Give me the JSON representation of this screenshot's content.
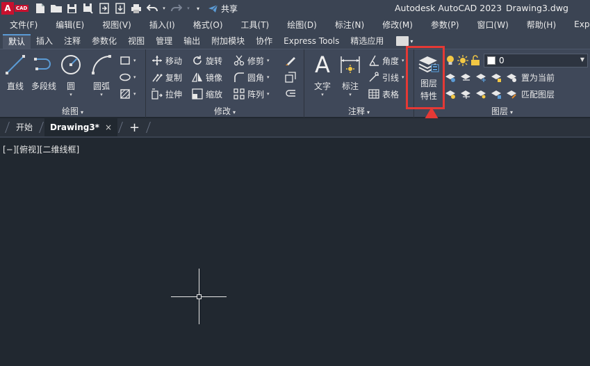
{
  "title_bar": {
    "logo_letter": "A",
    "logo_sub": "CAD",
    "share_label": "共享",
    "app_title": "Autodesk AutoCAD 2023",
    "file_name": "Drawing3.dwg",
    "quick_access_icons": [
      "new-icon",
      "open-icon",
      "save-icon",
      "save-as-icon",
      "open-web-icon",
      "save-web-icon",
      "plot-icon",
      "undo-icon",
      "redo-icon",
      "customize-icon",
      "share-icon"
    ]
  },
  "menu": [
    "文件(F)",
    "编辑(E)",
    "视图(V)",
    "插入(I)",
    "格式(O)",
    "工具(T)",
    "绘图(D)",
    "标注(N)",
    "修改(M)",
    "参数(P)",
    "窗口(W)",
    "帮助(H)",
    "Express"
  ],
  "ribbon_tabs": [
    {
      "label": "默认",
      "active": true
    },
    {
      "label": "插入"
    },
    {
      "label": "注释"
    },
    {
      "label": "参数化"
    },
    {
      "label": "视图"
    },
    {
      "label": "管理"
    },
    {
      "label": "输出"
    },
    {
      "label": "附加模块"
    },
    {
      "label": "协作"
    },
    {
      "label": "Express Tools"
    },
    {
      "label": "精选应用"
    }
  ],
  "panels": {
    "draw": {
      "title": "绘图",
      "tools": [
        {
          "label": "直线",
          "icon": "line-icon"
        },
        {
          "label": "多段线",
          "icon": "polyline-icon"
        },
        {
          "label": "圆",
          "icon": "circle-icon"
        },
        {
          "label": "圆弧",
          "icon": "arc-icon"
        }
      ]
    },
    "modify": {
      "title": "修改",
      "tools": [
        {
          "label": "移动",
          "icon": "move-icon"
        },
        {
          "label": "旋转",
          "icon": "rotate-icon"
        },
        {
          "label": "修剪",
          "icon": "trim-icon"
        },
        {
          "label": "复制",
          "icon": "copy-icon"
        },
        {
          "label": "镜像",
          "icon": "mirror-icon"
        },
        {
          "label": "圆角",
          "icon": "fillet-icon"
        },
        {
          "label": "拉伸",
          "icon": "stretch-icon"
        },
        {
          "label": "缩放",
          "icon": "scale-icon"
        },
        {
          "label": "阵列",
          "icon": "array-icon"
        }
      ]
    },
    "annotation": {
      "title": "注释",
      "tools": [
        {
          "label": "文字",
          "icon": "text-icon"
        },
        {
          "label": "标注",
          "icon": "dimension-icon"
        },
        {
          "label": "角度",
          "icon": "angle-icon"
        },
        {
          "label": "引线",
          "icon": "leader-icon"
        },
        {
          "label": "表格",
          "icon": "table-icon"
        }
      ]
    },
    "layers": {
      "title": "图层",
      "layer_properties_line1": "图层",
      "layer_properties_line2": "特性",
      "current_layer": "0",
      "set_current": "置为当前",
      "match_layer": "匹配图层"
    }
  },
  "doc_tabs": {
    "start": "开始",
    "active": "Drawing3*",
    "close": "×",
    "add": "+"
  },
  "viewport": {
    "label": "[−][俯视][二维线框]"
  },
  "colors": {
    "highlight": "#e53935",
    "accent": "#5b9bd5",
    "logo": "#c8102e"
  }
}
